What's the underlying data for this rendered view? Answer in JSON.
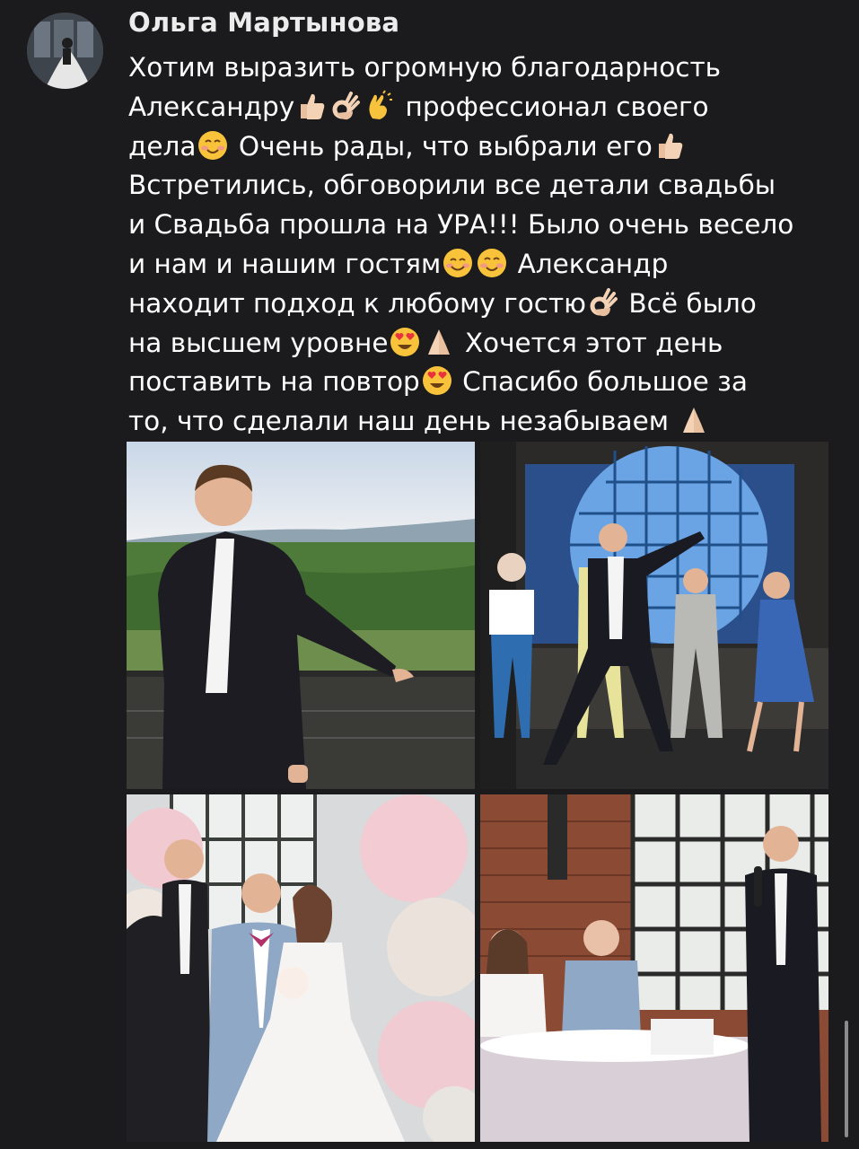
{
  "post": {
    "author": "Ольга Мартынова",
    "message": {
      "line1": {
        "a": "Хотим выразить огромную благодарность"
      },
      "line2": {
        "a": "Александру",
        "b": " профессионал своего"
      },
      "line3": {
        "a": "дела",
        "b": " Очень рады, что выбрали его"
      },
      "line4": {
        "a": "Встретились, обговорили все детали свадьбы"
      },
      "line5": {
        "a": "и Свадьба прошла на УРА!!! Было очень весело"
      },
      "line6": {
        "a": "и нам и нашим гостям",
        "b": " Александр"
      },
      "line7": {
        "a": "находит подход к любому гостю",
        "b": " Всё было"
      },
      "line8": {
        "a": "на высшем уровне",
        "b": " Хочется этот день"
      },
      "line9": {
        "a": "поставить на повтор",
        "b": " Спасибо большое за"
      },
      "line10": {
        "a": "то, что сделали наш день незабываем"
      }
    },
    "emoji": [
      "thumbs-up",
      "ok-hand",
      "clapping-hands",
      "smiling-face",
      "thumbs-up",
      "smiling-face-blush",
      "smiling-face",
      "ok-hand",
      "heart-eyes",
      "folded-hands",
      "heart-eyes",
      "folded-hands"
    ],
    "photos": [
      {
        "subject": "host-on-viewpoint"
      },
      {
        "subject": "dance-stage-disco-ball"
      },
      {
        "subject": "host-with-newlyweds"
      },
      {
        "subject": "host-with-microphone-at-table"
      }
    ]
  },
  "colors": {
    "background": "#1b1b1d",
    "text": "#ffffff",
    "author": "#ececec",
    "emoji_skin": "#f3d2b5",
    "emoji_face": "#f8c33a"
  }
}
